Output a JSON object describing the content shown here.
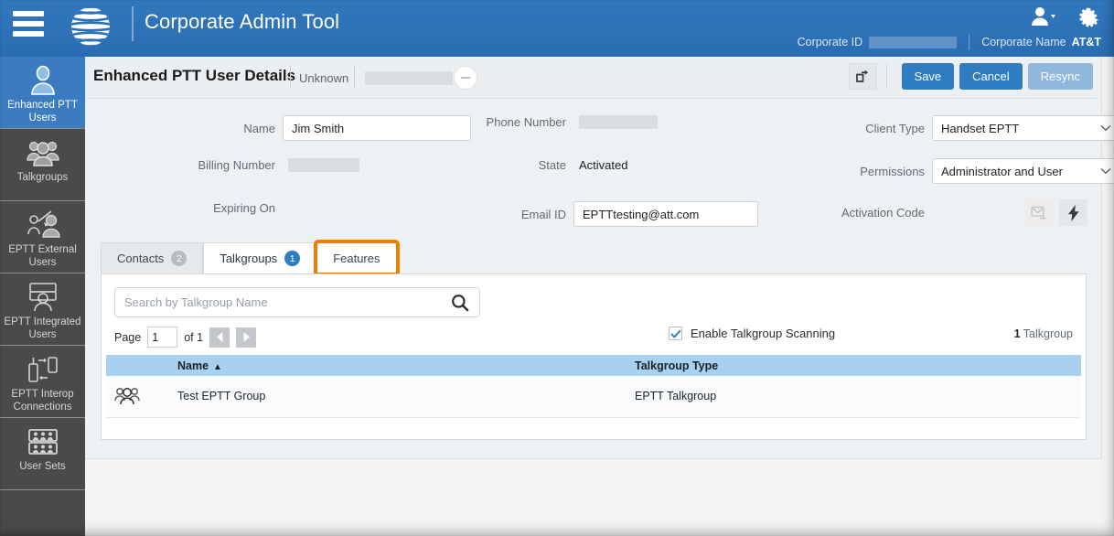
{
  "header": {
    "title": "Corporate Admin Tool",
    "menu_icon": "hamburger-icon",
    "logo_icon": "att-globe-logo",
    "user_icon": "user-dropdown-icon",
    "gear_icon": "gear-icon",
    "corporate_id_label": "Corporate ID",
    "corporate_id_value": "",
    "corporate_name_label": "Corporate Name",
    "corporate_name_value": "AT&T",
    "brand_color": "#2a70b8"
  },
  "sidebar": {
    "items": [
      {
        "label": "Enhanced PTT Users",
        "icon": "single-user-icon",
        "active": true
      },
      {
        "label": "Talkgroups",
        "icon": "user-group-icon",
        "active": false
      },
      {
        "label": "EPTT External Users",
        "icon": "external-user-icon",
        "active": false
      },
      {
        "label": "EPTT Integrated Users",
        "icon": "integrated-user-icon",
        "active": false
      },
      {
        "label": "EPTT Interop Connections",
        "icon": "interop-connection-icon",
        "active": false
      },
      {
        "label": "User Sets",
        "icon": "user-sets-icon",
        "active": false
      }
    ]
  },
  "detail": {
    "title": "Enhanced PTT User Details",
    "subtitle": "Unknown",
    "redacted_value": "",
    "collapse_icon": "minus-circle-icon",
    "export_icon": "share-export-icon",
    "buttons": {
      "save": "Save",
      "cancel": "Cancel",
      "resync": "Resync"
    }
  },
  "form": {
    "name_label": "Name",
    "name_value": "Jim Smith",
    "billing_number_label": "Billing Number",
    "billing_number_value": "",
    "expiring_on_label": "Expiring On",
    "expiring_on_value": "",
    "phone_number_label": "Phone Number",
    "phone_number_value": "",
    "state_label": "State",
    "state_value": "Activated",
    "email_id_label": "Email ID",
    "email_id_value": "EPTTtesting@att.com",
    "client_type_label": "Client Type",
    "client_type_value": "Handset EPTT",
    "permissions_label": "Permissions",
    "permissions_value": "Administrator and User",
    "activation_code_label": "Activation Code",
    "email_code_icon": "email-forward-icon",
    "generate_code_icon": "lightning-bolt-icon"
  },
  "tabs": [
    {
      "label": "Contacts",
      "badge": "2",
      "badge_color": "grey",
      "state": "inactive"
    },
    {
      "label": "Talkgroups",
      "badge": "1",
      "badge_color": "blue",
      "state": "selected"
    },
    {
      "label": "Features",
      "badge": "",
      "badge_color": "",
      "state": "highlighted"
    }
  ],
  "highlight_color": "#f07d00",
  "talkgroups_panel": {
    "search_placeholder": "Search by Talkgroup Name",
    "search_value": "",
    "search_icon": "search-icon",
    "page_label": "Page",
    "page_value": "1",
    "page_of": "of 1",
    "prev_icon": "prev-page-icon",
    "next_icon": "next-page-icon",
    "scanning_label": "Enable Talkgroup Scanning",
    "scanning_checked": true,
    "count_number": "1",
    "count_label": "Talkgroup",
    "table": {
      "columns": [
        "Name",
        "Talkgroup Type"
      ],
      "sort_column": "Name",
      "sort_direction": "asc",
      "sort_arrow": "▲",
      "rows": [
        {
          "icon": "talkgroup-icon",
          "name": "Test EPTT Group",
          "type": "EPTT Talkgroup"
        }
      ]
    }
  }
}
